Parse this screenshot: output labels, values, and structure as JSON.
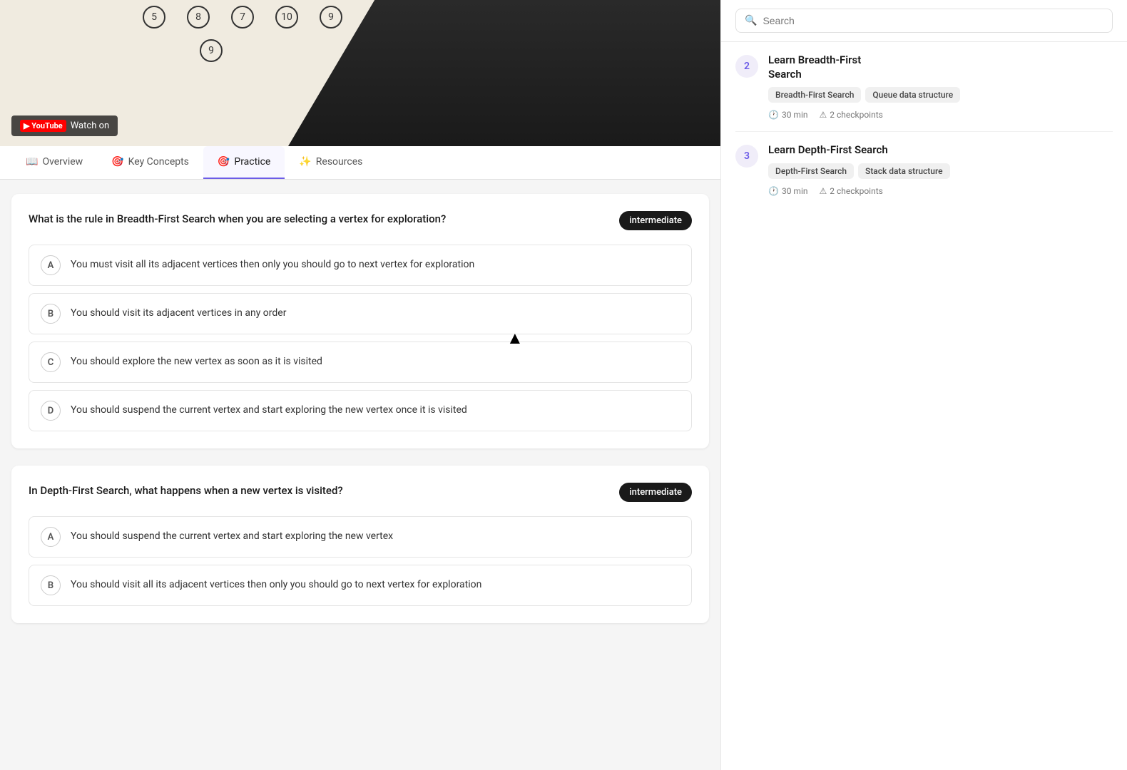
{
  "video": {
    "youtube_label": "Watch on",
    "youtube_brand": "YouTube",
    "numbers": [
      "5",
      "8",
      "7",
      "10",
      "9"
    ],
    "nine_node": "9"
  },
  "tabs": [
    {
      "id": "overview",
      "label": "Overview",
      "icon": "📖"
    },
    {
      "id": "key-concepts",
      "label": "Key Concepts",
      "icon": "🎯"
    },
    {
      "id": "practice",
      "label": "Practice",
      "icon": "🎯",
      "active": true
    },
    {
      "id": "resources",
      "label": "Resources",
      "icon": "✨"
    }
  ],
  "questions": [
    {
      "id": "q1",
      "text": "What is the rule in Breadth-First Search when you are selecting a vertex for exploration?",
      "difficulty": "intermediate",
      "options": [
        {
          "letter": "A",
          "text": "You must visit all its adjacent vertices then only you should go to next vertex for exploration"
        },
        {
          "letter": "B",
          "text": "You should visit its adjacent vertices in any order"
        },
        {
          "letter": "C",
          "text": "You should explore the new vertex as soon as it is visited"
        },
        {
          "letter": "D",
          "text": "You should suspend the current vertex and start exploring the new vertex once it is visited"
        }
      ]
    },
    {
      "id": "q2",
      "text": "In Depth-First Search, what happens when a new vertex is visited?",
      "difficulty": "intermediate",
      "options": [
        {
          "letter": "A",
          "text": "You should suspend the current vertex and start exploring the new vertex"
        },
        {
          "letter": "B",
          "text": "You should visit all its adjacent vertices then only you should go to next vertex for exploration"
        }
      ]
    }
  ],
  "sidebar": {
    "search_placeholder": "Search",
    "partial_lesson": {
      "number": "2",
      "title_prefix": "Learn Breadth-First",
      "title": "Search",
      "tags": [
        "Breadth-First Search",
        "Queue data structure"
      ],
      "time": "30 min",
      "checkpoints": "2 checkpoints"
    },
    "lessons": [
      {
        "number": "3",
        "title": "Learn Depth-First Search",
        "tags": [
          "Depth-First Search",
          "Stack data structure"
        ],
        "time": "30 min",
        "checkpoints": "2 checkpoints"
      }
    ]
  }
}
